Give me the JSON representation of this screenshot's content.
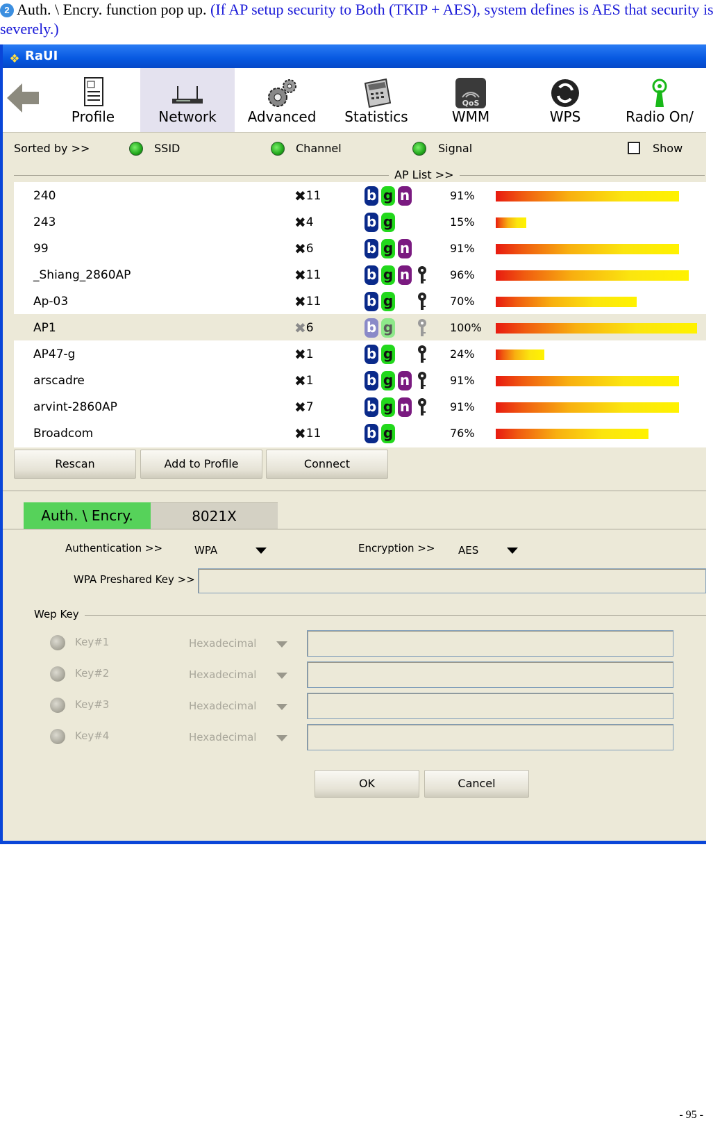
{
  "doc": {
    "step_number": "2",
    "heading": "Auth. \\ Encry. function pop up.",
    "note": "(If AP setup security to Both (TKIP + AES), system defines is AES that security is severely.)",
    "page_number": "- 95 -"
  },
  "window": {
    "title": "RaUI"
  },
  "toolbar": {
    "items": [
      {
        "label": "Profile",
        "icon": "profile-icon"
      },
      {
        "label": "Network",
        "icon": "network-icon",
        "active": true
      },
      {
        "label": "Advanced",
        "icon": "gears-icon"
      },
      {
        "label": "Statistics",
        "icon": "calculator-icon"
      },
      {
        "label": "WMM",
        "icon": "qos-icon"
      },
      {
        "label": "WPS",
        "icon": "wps-icon"
      },
      {
        "label": "Radio On/",
        "icon": "antenna-icon"
      }
    ]
  },
  "sortbar": {
    "sorted_by": "Sorted by >>",
    "ssid": "SSID",
    "channel": "Channel",
    "signal": "Signal",
    "show": "Show"
  },
  "ap_list": {
    "label": "AP List >>",
    "rows": [
      {
        "ssid": "240",
        "channel": "11",
        "b": "b",
        "g": "g",
        "n": "n",
        "secure": false,
        "signal": "91%",
        "level": 0.91
      },
      {
        "ssid": "243",
        "channel": "4",
        "b": "b",
        "g": "g",
        "n": "",
        "secure": false,
        "signal": "15%",
        "level": 0.15
      },
      {
        "ssid": "99",
        "channel": "6",
        "b": "b",
        "g": "g",
        "n": "n",
        "secure": false,
        "signal": "91%",
        "level": 0.91
      },
      {
        "ssid": "_Shiang_2860AP",
        "channel": "11",
        "b": "b",
        "g": "g",
        "n": "n",
        "secure": true,
        "signal": "96%",
        "level": 0.96
      },
      {
        "ssid": "Ap-03",
        "channel": "11",
        "b": "b",
        "g": "g",
        "n": "",
        "secure": true,
        "signal": "70%",
        "level": 0.7
      },
      {
        "ssid": "AP1",
        "channel": "6",
        "b": "b",
        "g": "g",
        "n": "",
        "secure": true,
        "signal": "100%",
        "level": 1.0,
        "selected": true
      },
      {
        "ssid": "AP47-g",
        "channel": "1",
        "b": "b",
        "g": "g",
        "n": "",
        "secure": true,
        "signal": "24%",
        "level": 0.24
      },
      {
        "ssid": "arscadre",
        "channel": "1",
        "b": "b",
        "g": "g",
        "n": "n",
        "secure": true,
        "signal": "91%",
        "level": 0.91
      },
      {
        "ssid": "arvint-2860AP",
        "channel": "7",
        "b": "b",
        "g": "g",
        "n": "n",
        "secure": true,
        "signal": "91%",
        "level": 0.91
      },
      {
        "ssid": "Broadcom",
        "channel": "11",
        "b": "b",
        "g": "g",
        "n": "",
        "secure": false,
        "signal": "76%",
        "level": 0.76
      }
    ]
  },
  "buttons": {
    "rescan": "Rescan",
    "add_to_profile": "Add to Profile",
    "connect": "Connect",
    "ok": "OK",
    "cancel": "Cancel"
  },
  "tabs": {
    "auth": "Auth. \\ Encry.",
    "x8021": "8021X"
  },
  "form": {
    "authentication_label": "Authentication >>",
    "authentication_value": "WPA",
    "encryption_label": "Encryption >>",
    "encryption_value": "AES",
    "psk_label": "WPA Preshared Key >>",
    "psk_value": "",
    "wep_key_label": "Wep Key",
    "wep_keys": [
      {
        "label": "Key#1",
        "format": "Hexadecimal",
        "value": ""
      },
      {
        "label": "Key#2",
        "format": "Hexadecimal",
        "value": ""
      },
      {
        "label": "Key#3",
        "format": "Hexadecimal",
        "value": ""
      },
      {
        "label": "Key#4",
        "format": "Hexadecimal",
        "value": ""
      }
    ]
  },
  "colors": {
    "title_bar": "#0758e0",
    "active_tab": "#56d25a",
    "window_bg": "#ece9d8",
    "signal_low": "#e81a10",
    "signal_high": "#fff200",
    "note_text": "#1a1ad8"
  }
}
